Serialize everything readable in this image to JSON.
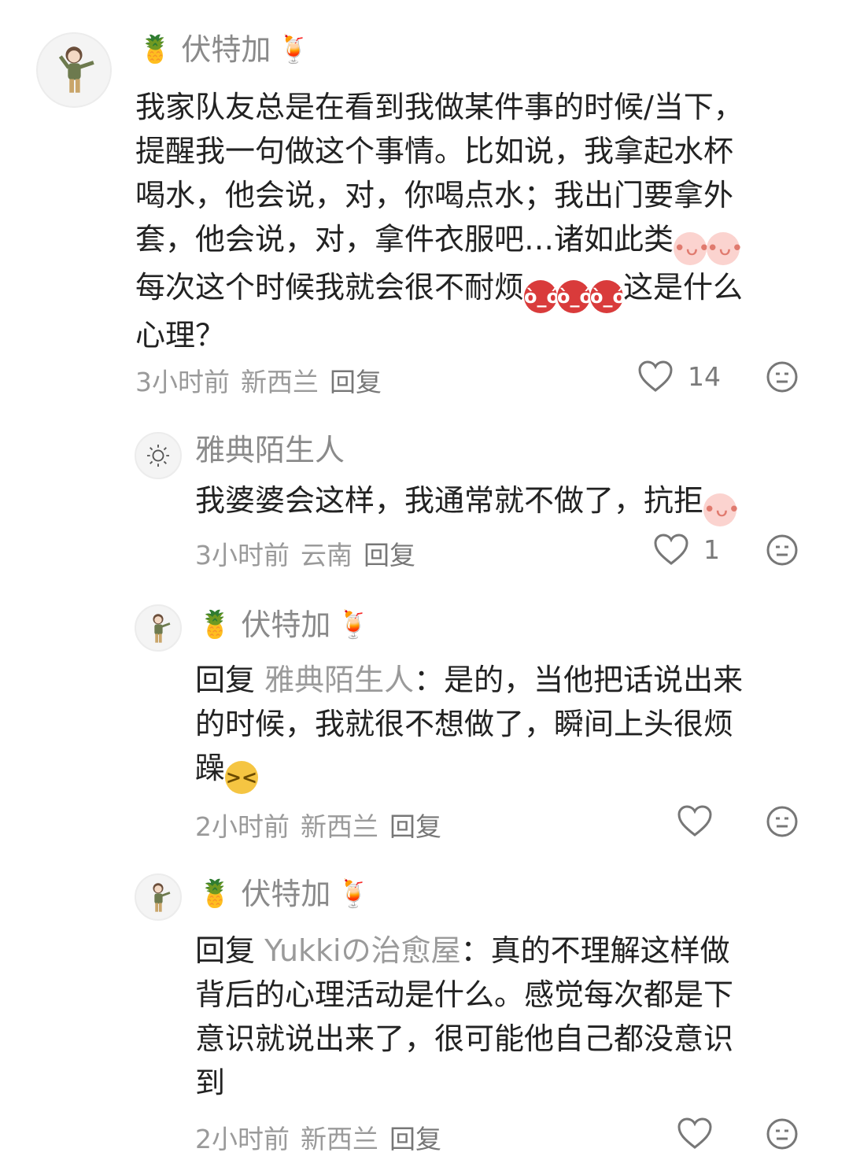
{
  "comments": [
    {
      "name": "伏特加",
      "name_prefix_icon": "pineapple-icon",
      "name_suffix_icon": "cocktail-icon",
      "text_lines": [
        "我家队友总是在看到我做某件事的时候/当下，",
        "提醒我一句做这个事情。比如说，我拿起水杯",
        "喝水，他会说，对，你喝点水；我出门要拿外",
        "套，他会说，对，拿件衣服吧…诸如此类",
        "每次这个时候我就会很不耐烦",
        "这是什么",
        "心理？"
      ],
      "time": "3小时前",
      "location": "新西兰",
      "reply": "回复",
      "likes": "14"
    },
    {
      "name": "雅典陌生人",
      "text": "我婆婆会这样，我通常就不做了，抗拒",
      "time": "3小时前",
      "location": "云南",
      "reply": "回复",
      "likes": "1"
    },
    {
      "name": "伏特加",
      "reply_prefix": "回复",
      "reply_to": "雅典陌生人",
      "text_lines": [
        "：是的，当他把话说出来",
        "的时候，我就很不想做了，瞬间上头很烦",
        "躁"
      ],
      "time": "2小时前",
      "location": "新西兰",
      "reply": "回复"
    },
    {
      "name": "伏特加",
      "reply_prefix": "回复",
      "reply_to": "Yukkiの治愈屋",
      "text_lines": [
        "：真的不理解这样做",
        "背后的心理活动是什么。感觉每次都是下",
        "意识就说出来了，很可能他自己都没意识",
        "到"
      ],
      "time": "2小时前",
      "location": "新西兰",
      "reply": "回复"
    }
  ],
  "emoji": {
    "pineapple": "🍍",
    "cocktail": "🍹",
    "peach": "•ᴗ•",
    "angry": "ò_ó",
    "tired": "><"
  },
  "colors": {
    "name": "#8a8a8a",
    "meta": "#9a9a9a",
    "text": "#222222"
  }
}
